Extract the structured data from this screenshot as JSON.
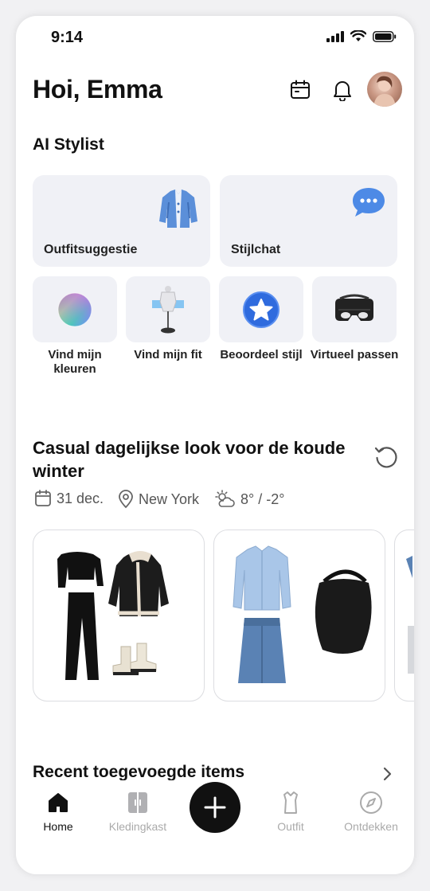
{
  "status_bar": {
    "time": "9:14"
  },
  "header": {
    "greeting": "Hoi, Emma",
    "icons": [
      "calendar-icon",
      "bell-icon",
      "profile-avatar"
    ]
  },
  "ai_stylist": {
    "title": "AI Stylist",
    "large_cards": [
      {
        "label": "Outfitsuggestie",
        "icon": "jacket-icon"
      },
      {
        "label": "Stijlchat",
        "icon": "chat-bubble-icon"
      }
    ],
    "small_cards": [
      {
        "label": "Vind mijn kleuren",
        "icon": "color-wheel-icon"
      },
      {
        "label": "Vind mijn fit",
        "icon": "mannequin-icon"
      },
      {
        "label": "Beoordeel stijl",
        "icon": "star-badge-icon"
      },
      {
        "label": "Virtueel passen",
        "icon": "vr-headset-icon"
      }
    ]
  },
  "daily_look": {
    "title": "Casual dagelijkse look voor de koude winter",
    "date": "31 dec.",
    "location": "New York",
    "weather": "8° / -2°",
    "outfits": [
      {
        "items": [
          "black-off-shoulder-top",
          "black-wide-trousers",
          "shearling-leather-jacket",
          "cream-chelsea-boots"
        ]
      },
      {
        "items": [
          "light-blue-shirt",
          "denim-midi-skirt",
          "black-hobo-bag"
        ]
      }
    ],
    "accent": "#5b8fd9"
  },
  "recent": {
    "title": "Recent toegevoegde items"
  },
  "tab_bar": {
    "tabs": [
      {
        "label": "Home",
        "icon": "home-icon",
        "active": true
      },
      {
        "label": "Kledingkast",
        "icon": "wardrobe-icon",
        "active": false
      },
      {
        "label": "",
        "icon": "plus-icon",
        "active": false
      },
      {
        "label": "Outfit",
        "icon": "shirt-icon",
        "active": false
      },
      {
        "label": "Ontdekken",
        "icon": "compass-icon",
        "active": false
      }
    ]
  }
}
